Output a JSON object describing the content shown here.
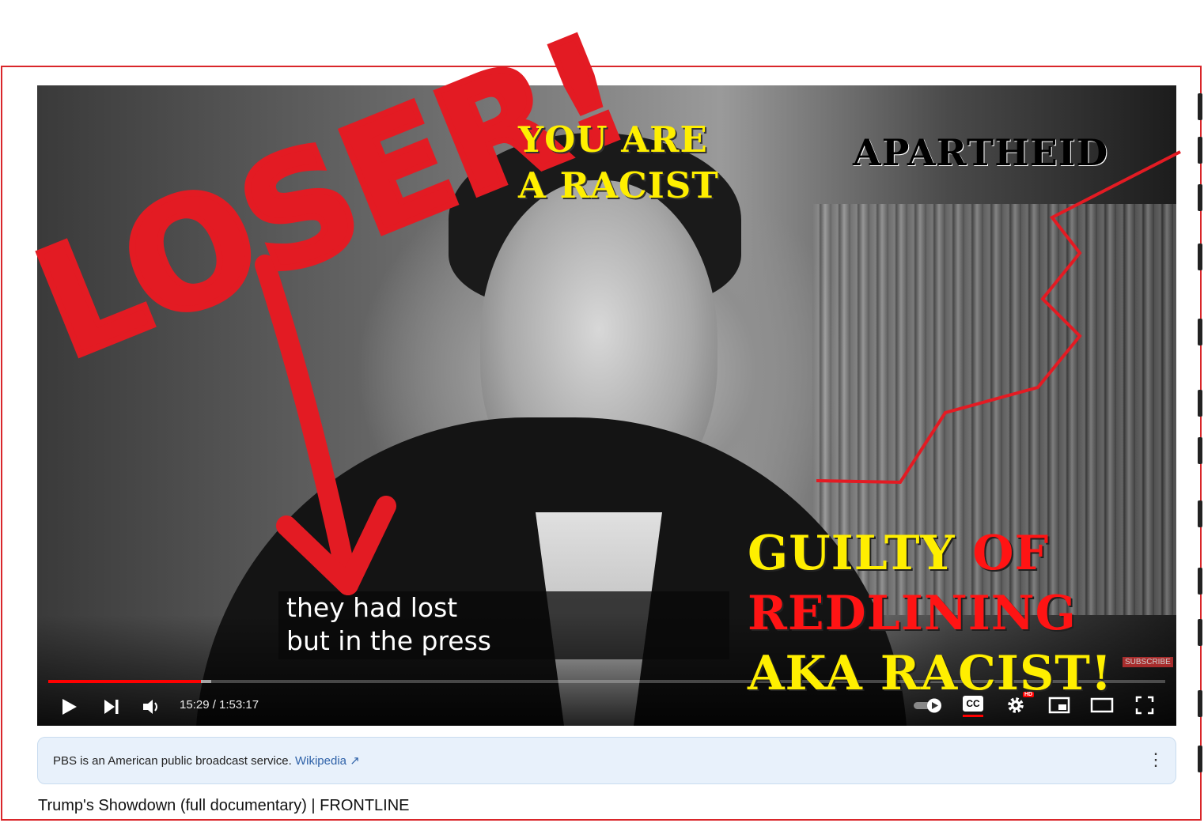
{
  "video": {
    "captions": [
      "they had lost",
      "but in the press"
    ],
    "time_display": "15:29 / 1:53:17",
    "progress_fraction": 0.137,
    "buffered_fraction": 0.146,
    "controls": {
      "play_icon": "play-icon",
      "next_icon": "next-icon",
      "volume_icon": "volume-icon",
      "autoplay_icon": "autoplay-toggle-icon",
      "cc_label": "CC",
      "settings_icon": "gear-icon",
      "hd_label": "HD",
      "miniplayer_icon": "miniplayer-icon",
      "theater_icon": "theater-mode-icon",
      "fullscreen_icon": "fullscreen-icon"
    },
    "subscribe_badge": "SUBSCRIBE"
  },
  "annotations": {
    "loser": "LOSER!",
    "racist_line1": "YOU ARE",
    "racist_line2": "A RACIST",
    "apartheid": "APARTHEID",
    "guilty_word": "GUILTY",
    "of_word": "OF",
    "redlining": "REDLINING",
    "aka_racist": "AKA RACIST!",
    "colors": {
      "marker_red": "#e31b23",
      "yellow": "#ffef00"
    }
  },
  "info_panel": {
    "text": "PBS is an American public broadcast service.",
    "link": "Wikipedia",
    "link_icon": "external-link-icon",
    "menu_icon": "more-vert-icon"
  },
  "title": "Trump's Showdown (full documentary) | FRONTLINE"
}
